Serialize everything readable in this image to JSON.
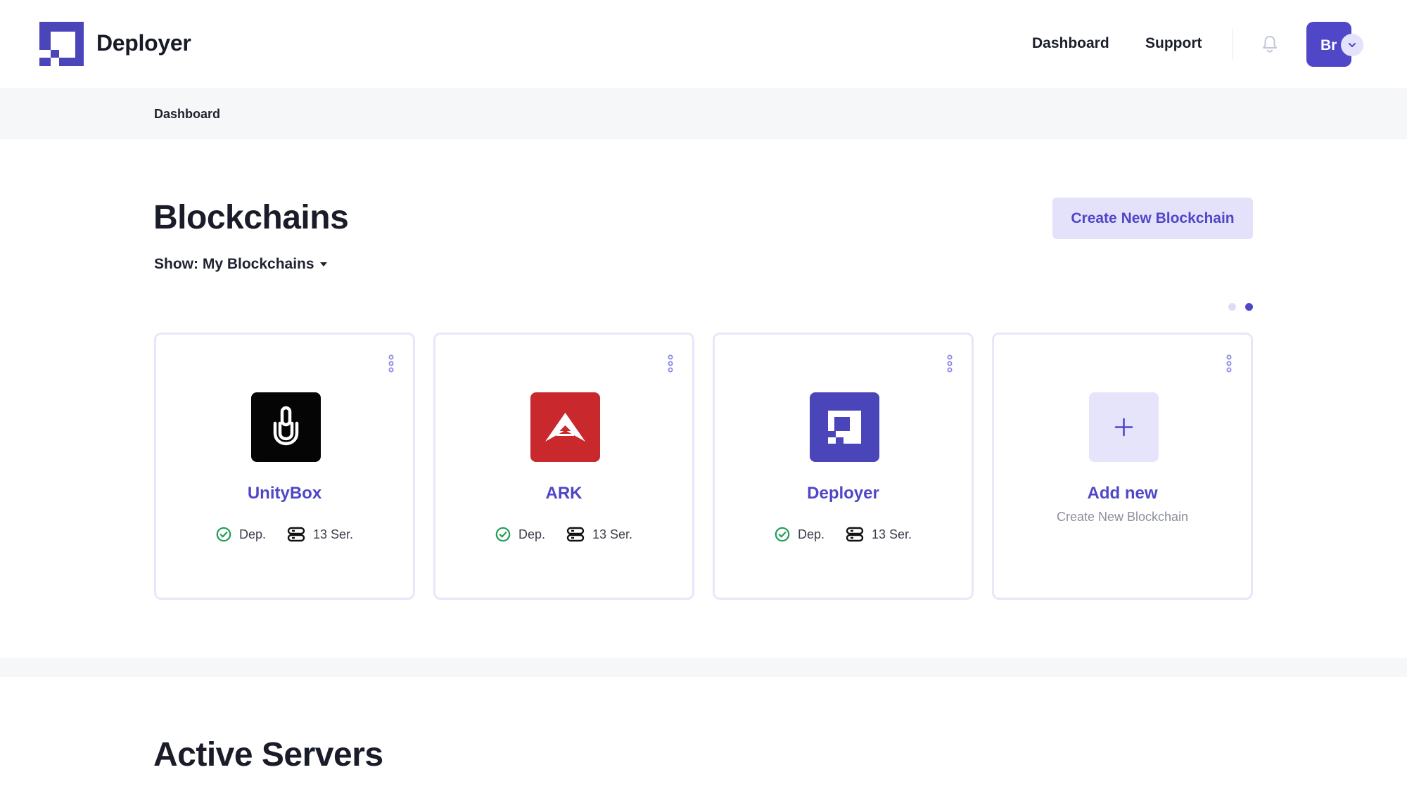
{
  "header": {
    "brand": "Deployer",
    "nav": {
      "dashboard": "Dashboard",
      "support": "Support"
    },
    "notification_icon": "bell-icon",
    "avatar_initials": "Br",
    "avatar_dropdown_icon": "chevron-down-icon"
  },
  "breadcrumb": {
    "current": "Dashboard"
  },
  "blockchains": {
    "title": "Blockchains",
    "filter_label": "Show: My Blockchains",
    "create_button": "Create New Blockchain",
    "pagination": {
      "pages": 2,
      "current": 2
    },
    "items": [
      {
        "name": "UnityBox",
        "status": "Dep.",
        "servers": "13 Ser.",
        "logo": "unitybox-logo",
        "logo_color": "#050505"
      },
      {
        "name": "ARK",
        "status": "Dep.",
        "servers": "13 Ser.",
        "logo": "ark-logo",
        "logo_color": "#c9282d"
      },
      {
        "name": "Deployer",
        "status": "Dep.",
        "servers": "13 Ser.",
        "logo": "deployer-logo",
        "logo_color": "#4a45b8"
      }
    ],
    "add_new": {
      "title": "Add new",
      "subtitle": "Create New Blockchain",
      "icon": "plus-icon"
    }
  },
  "active_servers": {
    "title": "Active Servers"
  },
  "colors": {
    "accent": "#4f46c8",
    "accent_light": "#e4e2fb",
    "status_ok": "#1f9d55",
    "page_band": "#f5f7f9"
  }
}
